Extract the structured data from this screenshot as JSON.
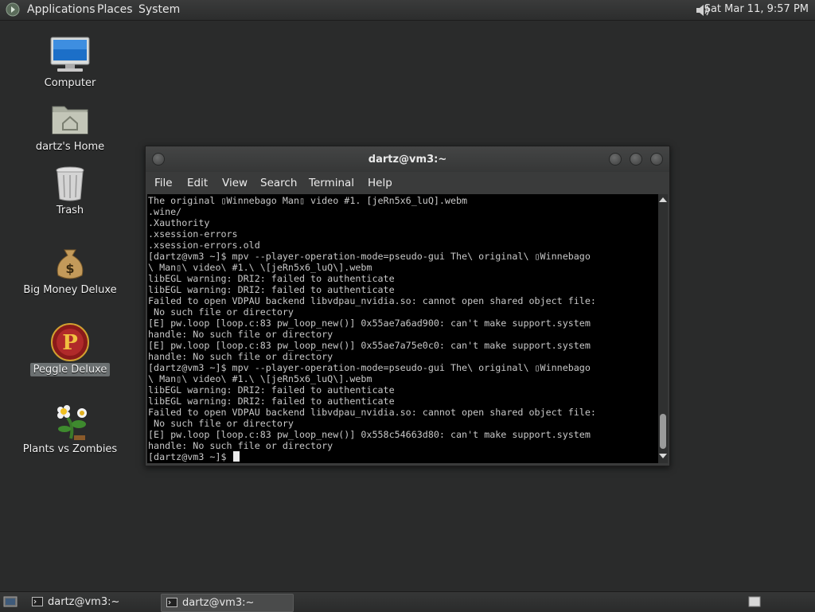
{
  "top_panel": {
    "menus": [
      "Applications",
      "Places",
      "System"
    ],
    "clock": "Sat Mar 11,  9:57 PM",
    "logo_icon": "gnome-foot-icon",
    "volume_icon": "speaker-icon"
  },
  "desktop": {
    "icons": [
      {
        "label": "Computer",
        "icon": "computer-icon"
      },
      {
        "label": "dartz's Home",
        "icon": "home-folder-icon"
      },
      {
        "label": "Trash",
        "icon": "trash-icon"
      },
      {
        "label": "Big Money Deluxe",
        "icon": "money-bag-icon"
      },
      {
        "label": "Peggle Deluxe",
        "icon": "peggle-icon",
        "selected": true
      },
      {
        "label": "Plants vs Zombies",
        "icon": "plants-vs-zombies-icon"
      }
    ]
  },
  "terminal": {
    "title": "dartz@vm3:~",
    "menu": [
      "File",
      "Edit",
      "View",
      "Search",
      "Terminal",
      "Help"
    ],
    "lines": [
      "The original ▯Winnebago Man▯ video #1. [jeRn5x6_luQ].webm",
      ".wine/",
      ".Xauthority",
      ".xsession-errors",
      ".xsession-errors.old",
      "[dartz@vm3 ~]$ mpv --player-operation-mode=pseudo-gui The\\ original\\ ▯Winnebago",
      "\\ Man▯\\ video\\ #1.\\ \\[jeRn5x6_luQ\\].webm",
      "libEGL warning: DRI2: failed to authenticate",
      "libEGL warning: DRI2: failed to authenticate",
      "Failed to open VDPAU backend libvdpau_nvidia.so: cannot open shared object file:",
      " No such file or directory",
      "[E] pw.loop [loop.c:83 pw_loop_new()] 0x55ae7a6ad900: can't make support.system",
      "handle: No such file or directory",
      "[E] pw.loop [loop.c:83 pw_loop_new()] 0x55ae7a75e0c0: can't make support.system",
      "handle: No such file or directory",
      "[dartz@vm3 ~]$ mpv --player-operation-mode=pseudo-gui The\\ original\\ ▯Winnebago",
      "\\ Man▯\\ video\\ #1.\\ \\[jeRn5x6_luQ\\].webm",
      "libEGL warning: DRI2: failed to authenticate",
      "libEGL warning: DRI2: failed to authenticate",
      "Failed to open VDPAU backend libvdpau_nvidia.so: cannot open shared object file:",
      " No such file or directory",
      "[E] pw.loop [loop.c:83 pw_loop_new()] 0x558c54663d80: can't make support.system",
      "handle: No such file or directory",
      "[dartz@vm3 ~]$ "
    ],
    "scroll_position": 0.9
  },
  "taskbar": {
    "show_desktop_icon": "show-desktop-icon",
    "tasks": [
      {
        "label": "dartz@vm3:~",
        "active": false
      },
      {
        "label": "dartz@vm3:~",
        "active": true
      }
    ],
    "workspace_icon": "workspace-switcher-icon"
  }
}
